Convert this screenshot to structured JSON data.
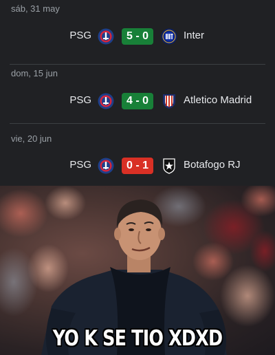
{
  "matches": [
    {
      "date": "sáb, 31 may",
      "home": "PSG",
      "score": "5 - 0",
      "away": "Inter",
      "result_color": "#188038"
    },
    {
      "date": "dom, 15 jun",
      "home": "PSG",
      "score": "4 - 0",
      "away": "Atletico Madrid",
      "result_color": "#188038"
    },
    {
      "date": "vie, 20 jun",
      "home": "PSG",
      "score": "0 - 1",
      "away": "Botafogo RJ",
      "result_color": "#d93025"
    }
  ],
  "meme": {
    "caption": "YO K SE TIO XDXD"
  }
}
